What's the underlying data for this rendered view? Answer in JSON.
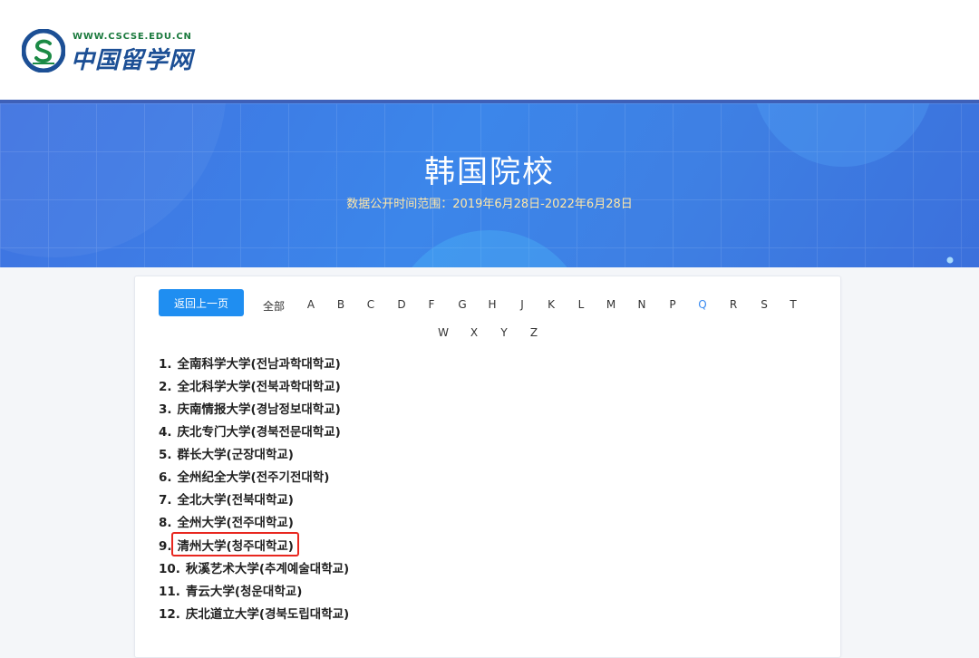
{
  "header": {
    "logo_url_text": "WWW.CSCSE.EDU.CN",
    "logo_cn_text": "中国留学网"
  },
  "banner": {
    "title": "韩国院校",
    "subtitle": "数据公开时间范围：2019年6月28日-2022年6月28日"
  },
  "toolbar": {
    "back_label": "返回上一页",
    "filters": [
      "全部",
      "A",
      "B",
      "C",
      "D",
      "F",
      "G",
      "H",
      "J",
      "K",
      "L",
      "M",
      "N",
      "P",
      "Q",
      "R",
      "S",
      "T",
      "W",
      "X",
      "Y",
      "Z"
    ],
    "active_filter": "Q"
  },
  "universities": [
    {
      "num": "1.",
      "name": "全南科学大学(전남과학대학교)"
    },
    {
      "num": "2.",
      "name": "全北科学大学(전북과학대학교)"
    },
    {
      "num": "3.",
      "name": "庆南情报大学(경남정보대학교)"
    },
    {
      "num": "4.",
      "name": "庆北专门大学(경북전문대학교)"
    },
    {
      "num": "5.",
      "name": "群长大学(군장대학교)"
    },
    {
      "num": "6.",
      "name": "全州纪全大学(전주기전대학)"
    },
    {
      "num": "7.",
      "name": "全北大学(전북대학교)"
    },
    {
      "num": "8.",
      "name": "全州大学(전주대학교)"
    },
    {
      "num": "9.",
      "name": "清州大学(청주대학교)"
    },
    {
      "num": "10.",
      "name": "秋溪艺术大学(추계예술대학교)"
    },
    {
      "num": "11.",
      "name": "青云大学(청운대학교)"
    },
    {
      "num": "12.",
      "name": "庆北道立大学(경북도립대학교)"
    }
  ],
  "highlighted_item": "清州大学(청주대학교)",
  "colors": {
    "brand_blue": "#1f8ef1",
    "banner_blue": "#3c86ea",
    "highlight_red": "#e8271f",
    "subtitle_gold": "#ffe7a8"
  }
}
